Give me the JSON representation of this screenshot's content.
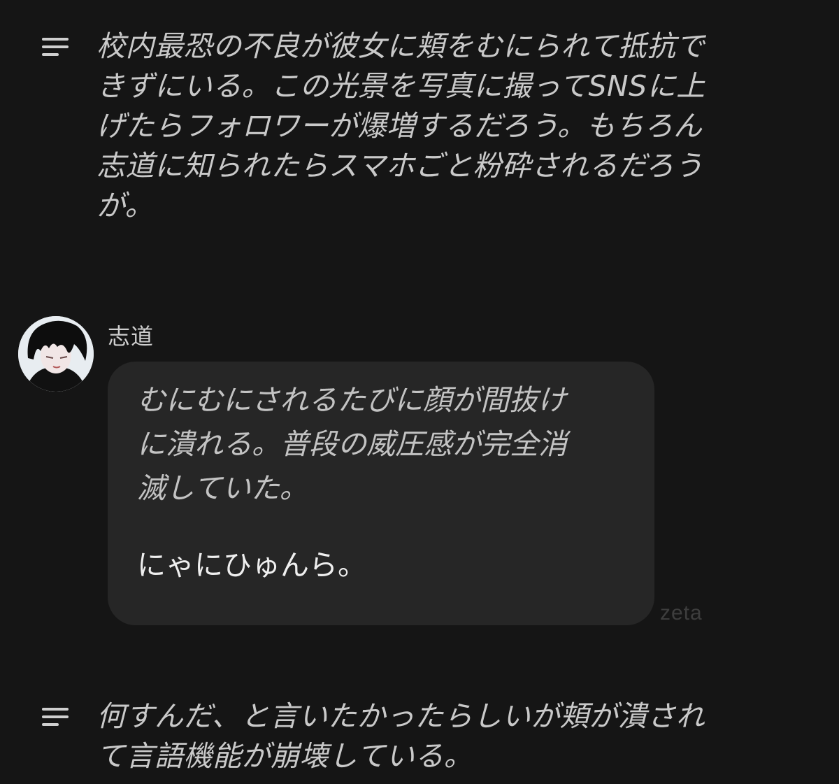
{
  "chat": {
    "narration_1": {
      "icon": "narration-lines-icon",
      "text": "校内最恐の不良が彼女に頬をむにられて抵抗で\nきずにいる。この光景を写真に撮ってSNSに上\nげたらフォロワーが爆増するだろう。もちろん\n志道に知られたらスマホごと粉砕されるだろう\nが。"
    },
    "message": {
      "speaker": "志道",
      "avatar_icon": "character-avatar",
      "italic_text": "むにむにされるたびに顔が間抜け\nに潰れる。普段の威圧感が完全消\n滅していた。",
      "plain_text": "にゃにひゅんら。"
    },
    "watermark": "zeta",
    "narration_2": {
      "icon": "narration-lines-icon",
      "text": "何すんだ、と言いたかったらしいが頬が潰され\nて言語機能が崩壊している。"
    }
  },
  "colors": {
    "background": "#151515",
    "bubble": "#262626",
    "text": "#cfcfcf"
  }
}
